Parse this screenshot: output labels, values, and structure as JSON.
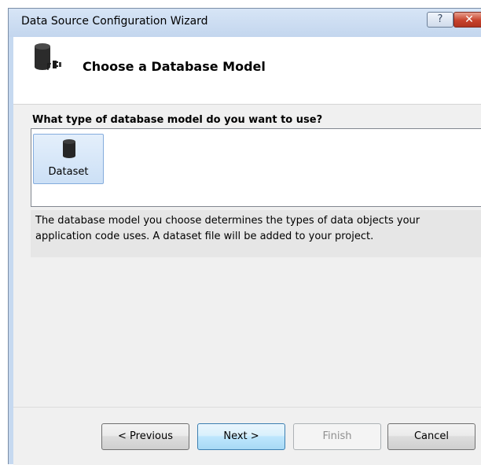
{
  "window": {
    "title": "Data Source Configuration Wizard",
    "help_label": "?",
    "close_label": "✕"
  },
  "header": {
    "title": "Choose a Database Model",
    "icon": "database-connect-icon"
  },
  "main": {
    "question": "What type of database model do you want to use?",
    "models": [
      {
        "label": "Dataset",
        "icon": "database-icon",
        "selected": true
      }
    ],
    "description": "The database model you choose determines the types of data objects your application code uses. A dataset file will be added to your project."
  },
  "footer": {
    "previous_label": "< Previous",
    "next_label": "Next >",
    "finish_label": "Finish",
    "cancel_label": "Cancel"
  },
  "colors": {
    "titlebar": "#c6d9f0",
    "close_button": "#c7422c",
    "selection": "#cce0f6"
  }
}
